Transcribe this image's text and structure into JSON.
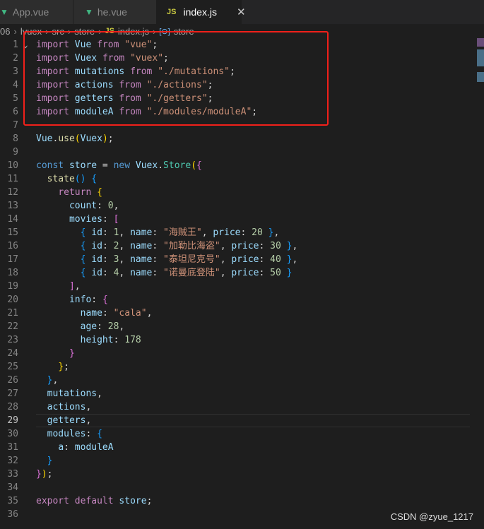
{
  "tabs": [
    {
      "label": "App.vue",
      "icon": "vue-icon"
    },
    {
      "label": "he.vue",
      "icon": "vue-icon"
    },
    {
      "label": "index.js",
      "icon": "js-icon",
      "active": true
    }
  ],
  "breadcrumb": [
    "06",
    "lvuex",
    "src",
    "store",
    "index.js",
    "store"
  ],
  "watermark": "CSDN @zyue_1217",
  "current_line": 29,
  "colors": {
    "keyword": "#c586c0",
    "storage": "#569cd6",
    "string": "#ce9178",
    "number": "#b5cea8",
    "variable": "#9cdcfe",
    "class": "#4ec9b0",
    "function": "#dcdcaa",
    "highlight_box": "#f0201a"
  },
  "lines": [
    [
      [
        "kw",
        "import"
      ],
      [
        "p",
        " "
      ],
      [
        "var",
        "Vue"
      ],
      [
        "p",
        " "
      ],
      [
        "kw",
        "from"
      ],
      [
        "p",
        " "
      ],
      [
        "str",
        "\"vue\""
      ],
      [
        "p",
        ";"
      ]
    ],
    [
      [
        "kw",
        "import"
      ],
      [
        "p",
        " "
      ],
      [
        "var",
        "Vuex"
      ],
      [
        "p",
        " "
      ],
      [
        "kw",
        "from"
      ],
      [
        "p",
        " "
      ],
      [
        "str",
        "\"vuex\""
      ],
      [
        "p",
        ";"
      ]
    ],
    [
      [
        "kw",
        "import"
      ],
      [
        "p",
        " "
      ],
      [
        "var",
        "mutations"
      ],
      [
        "p",
        " "
      ],
      [
        "kw",
        "from"
      ],
      [
        "p",
        " "
      ],
      [
        "str",
        "\"./mutations\""
      ],
      [
        "p",
        ";"
      ]
    ],
    [
      [
        "kw",
        "import"
      ],
      [
        "p",
        " "
      ],
      [
        "var",
        "actions"
      ],
      [
        "p",
        " "
      ],
      [
        "kw",
        "from"
      ],
      [
        "p",
        " "
      ],
      [
        "str",
        "\"./actions\""
      ],
      [
        "p",
        ";"
      ]
    ],
    [
      [
        "kw",
        "import"
      ],
      [
        "p",
        " "
      ],
      [
        "var",
        "getters"
      ],
      [
        "p",
        " "
      ],
      [
        "kw",
        "from"
      ],
      [
        "p",
        " "
      ],
      [
        "str",
        "\"./getters\""
      ],
      [
        "p",
        ";"
      ]
    ],
    [
      [
        "kw",
        "import"
      ],
      [
        "p",
        " "
      ],
      [
        "var",
        "moduleA"
      ],
      [
        "p",
        " "
      ],
      [
        "kw",
        "from"
      ],
      [
        "p",
        " "
      ],
      [
        "str",
        "\"./modules/moduleA\""
      ],
      [
        "p",
        ";"
      ]
    ],
    [],
    [
      [
        "var",
        "Vue"
      ],
      [
        "p",
        "."
      ],
      [
        "fn",
        "use"
      ],
      [
        "b1",
        "("
      ],
      [
        "var",
        "Vuex"
      ],
      [
        "b1",
        ")"
      ],
      [
        "p",
        ";"
      ]
    ],
    [],
    [
      [
        "st",
        "const"
      ],
      [
        "p",
        " "
      ],
      [
        "var",
        "store"
      ],
      [
        "p",
        " = "
      ],
      [
        "st",
        "new"
      ],
      [
        "p",
        " "
      ],
      [
        "var",
        "Vuex"
      ],
      [
        "p",
        "."
      ],
      [
        "cls",
        "Store"
      ],
      [
        "b1",
        "("
      ],
      [
        "b2",
        "{"
      ]
    ],
    [
      [
        "p",
        "  "
      ],
      [
        "fn",
        "state"
      ],
      [
        "b3",
        "()"
      ],
      [
        "p",
        " "
      ],
      [
        "b3",
        "{"
      ]
    ],
    [
      [
        "p",
        "    "
      ],
      [
        "kw",
        "return"
      ],
      [
        "p",
        " "
      ],
      [
        "b1",
        "{"
      ]
    ],
    [
      [
        "p",
        "      "
      ],
      [
        "var",
        "count"
      ],
      [
        "p",
        ": "
      ],
      [
        "num",
        "0"
      ],
      [
        "p",
        ","
      ]
    ],
    [
      [
        "p",
        "      "
      ],
      [
        "var",
        "movies"
      ],
      [
        "p",
        ": "
      ],
      [
        "b2",
        "["
      ]
    ],
    [
      [
        "p",
        "        "
      ],
      [
        "b3",
        "{"
      ],
      [
        "p",
        " "
      ],
      [
        "var",
        "id"
      ],
      [
        "p",
        ": "
      ],
      [
        "num",
        "1"
      ],
      [
        "p",
        ", "
      ],
      [
        "var",
        "name"
      ],
      [
        "p",
        ": "
      ],
      [
        "str",
        "\"海贼王\""
      ],
      [
        "p",
        ", "
      ],
      [
        "var",
        "price"
      ],
      [
        "p",
        ": "
      ],
      [
        "num",
        "20"
      ],
      [
        "p",
        " "
      ],
      [
        "b3",
        "}"
      ],
      [
        "p",
        ","
      ]
    ],
    [
      [
        "p",
        "        "
      ],
      [
        "b3",
        "{"
      ],
      [
        "p",
        " "
      ],
      [
        "var",
        "id"
      ],
      [
        "p",
        ": "
      ],
      [
        "num",
        "2"
      ],
      [
        "p",
        ", "
      ],
      [
        "var",
        "name"
      ],
      [
        "p",
        ": "
      ],
      [
        "str",
        "\"加勒比海盗\""
      ],
      [
        "p",
        ", "
      ],
      [
        "var",
        "price"
      ],
      [
        "p",
        ": "
      ],
      [
        "num",
        "30"
      ],
      [
        "p",
        " "
      ],
      [
        "b3",
        "}"
      ],
      [
        "p",
        ","
      ]
    ],
    [
      [
        "p",
        "        "
      ],
      [
        "b3",
        "{"
      ],
      [
        "p",
        " "
      ],
      [
        "var",
        "id"
      ],
      [
        "p",
        ": "
      ],
      [
        "num",
        "3"
      ],
      [
        "p",
        ", "
      ],
      [
        "var",
        "name"
      ],
      [
        "p",
        ": "
      ],
      [
        "str",
        "\"泰坦尼克号\""
      ],
      [
        "p",
        ", "
      ],
      [
        "var",
        "price"
      ],
      [
        "p",
        ": "
      ],
      [
        "num",
        "40"
      ],
      [
        "p",
        " "
      ],
      [
        "b3",
        "}"
      ],
      [
        "p",
        ","
      ]
    ],
    [
      [
        "p",
        "        "
      ],
      [
        "b3",
        "{"
      ],
      [
        "p",
        " "
      ],
      [
        "var",
        "id"
      ],
      [
        "p",
        ": "
      ],
      [
        "num",
        "4"
      ],
      [
        "p",
        ", "
      ],
      [
        "var",
        "name"
      ],
      [
        "p",
        ": "
      ],
      [
        "str",
        "\"诺曼底登陆\""
      ],
      [
        "p",
        ", "
      ],
      [
        "var",
        "price"
      ],
      [
        "p",
        ": "
      ],
      [
        "num",
        "50"
      ],
      [
        "p",
        " "
      ],
      [
        "b3",
        "}"
      ]
    ],
    [
      [
        "p",
        "      "
      ],
      [
        "b2",
        "]"
      ],
      [
        "p",
        ","
      ]
    ],
    [
      [
        "p",
        "      "
      ],
      [
        "var",
        "info"
      ],
      [
        "p",
        ": "
      ],
      [
        "b2",
        "{"
      ]
    ],
    [
      [
        "p",
        "        "
      ],
      [
        "var",
        "name"
      ],
      [
        "p",
        ": "
      ],
      [
        "str",
        "\"cala\""
      ],
      [
        "p",
        ","
      ]
    ],
    [
      [
        "p",
        "        "
      ],
      [
        "var",
        "age"
      ],
      [
        "p",
        ": "
      ],
      [
        "num",
        "28"
      ],
      [
        "p",
        ","
      ]
    ],
    [
      [
        "p",
        "        "
      ],
      [
        "var",
        "height"
      ],
      [
        "p",
        ": "
      ],
      [
        "num",
        "178"
      ]
    ],
    [
      [
        "p",
        "      "
      ],
      [
        "b2",
        "}"
      ]
    ],
    [
      [
        "p",
        "    "
      ],
      [
        "b1",
        "}"
      ],
      [
        "p",
        ";"
      ]
    ],
    [
      [
        "p",
        "  "
      ],
      [
        "b3",
        "}"
      ],
      [
        "p",
        ","
      ]
    ],
    [
      [
        "p",
        "  "
      ],
      [
        "var",
        "mutations"
      ],
      [
        "p",
        ","
      ]
    ],
    [
      [
        "p",
        "  "
      ],
      [
        "var",
        "actions"
      ],
      [
        "p",
        ","
      ]
    ],
    [
      [
        "p",
        "  "
      ],
      [
        "var",
        "getters"
      ],
      [
        "p",
        ","
      ]
    ],
    [
      [
        "p",
        "  "
      ],
      [
        "var",
        "modules"
      ],
      [
        "p",
        ": "
      ],
      [
        "b3",
        "{"
      ]
    ],
    [
      [
        "p",
        "    "
      ],
      [
        "var",
        "a"
      ],
      [
        "p",
        ": "
      ],
      [
        "var",
        "moduleA"
      ]
    ],
    [
      [
        "p",
        "  "
      ],
      [
        "b3",
        "}"
      ]
    ],
    [
      [
        "b2",
        "}"
      ],
      [
        "b1",
        ")"
      ],
      [
        "p",
        ";"
      ]
    ],
    [],
    [
      [
        "kw",
        "export"
      ],
      [
        "p",
        " "
      ],
      [
        "kw",
        "default"
      ],
      [
        "p",
        " "
      ],
      [
        "var",
        "store"
      ],
      [
        "p",
        ";"
      ]
    ],
    []
  ]
}
